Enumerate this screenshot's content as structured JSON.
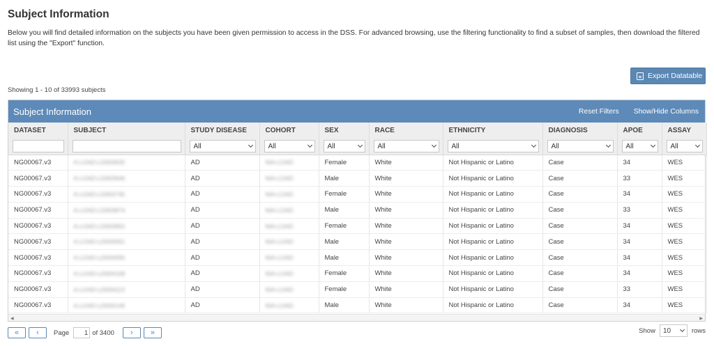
{
  "page": {
    "title": "Subject Information",
    "intro": "Below you will find detailed information on the subjects you have been given permission to access in the DSS. For advanced browsing, use the filtering functionality to find a subset of samples, then download the filtered list using the \"Export\" function.",
    "export_label": "Export Datatable",
    "showing": "Showing 1 - 10 of 33993 subjects"
  },
  "panel": {
    "title": "Subject Information",
    "reset_filters": "Reset Filters",
    "show_hide_columns": "Show/Hide Columns"
  },
  "columns": [
    "DATASET",
    "SUBJECT",
    "STUDY DISEASE",
    "COHORT",
    "SEX",
    "RACE",
    "ETHNICITY",
    "DIAGNOSIS",
    "APOE",
    "ASSAY"
  ],
  "filters": {
    "dataset": "",
    "subject": "",
    "study_disease": "All",
    "cohort": "All",
    "sex": "All",
    "race": "All",
    "ethnicity": "All",
    "diagnosis": "All",
    "apoe": "All",
    "assay": "All"
  },
  "rows": [
    {
      "dataset": "NG00067.v3",
      "subject": "A-LOAD-LD003635",
      "study_disease": "AD",
      "cohort": "NIA-LOAD",
      "sex": "Female",
      "race": "White",
      "ethnicity": "Not Hispanic or Latino",
      "diagnosis": "Case",
      "apoe": "34",
      "assay": "WES"
    },
    {
      "dataset": "NG00067.v3",
      "subject": "A-LOAD-LD003646",
      "study_disease": "AD",
      "cohort": "NIA-LOAD",
      "sex": "Male",
      "race": "White",
      "ethnicity": "Not Hispanic or Latino",
      "diagnosis": "Case",
      "apoe": "33",
      "assay": "WES"
    },
    {
      "dataset": "NG00067.v3",
      "subject": "A-LOAD-LD003745",
      "study_disease": "AD",
      "cohort": "NIA-LOAD",
      "sex": "Female",
      "race": "White",
      "ethnicity": "Not Hispanic or Latino",
      "diagnosis": "Case",
      "apoe": "34",
      "assay": "WES"
    },
    {
      "dataset": "NG00067.v3",
      "subject": "A-LOAD-LD003874",
      "study_disease": "AD",
      "cohort": "NIA-LOAD",
      "sex": "Male",
      "race": "White",
      "ethnicity": "Not Hispanic or Latino",
      "diagnosis": "Case",
      "apoe": "33",
      "assay": "WES"
    },
    {
      "dataset": "NG00067.v3",
      "subject": "A-LOAD-LD003952",
      "study_disease": "AD",
      "cohort": "NIA-LOAD",
      "sex": "Female",
      "race": "White",
      "ethnicity": "Not Hispanic or Latino",
      "diagnosis": "Case",
      "apoe": "34",
      "assay": "WES"
    },
    {
      "dataset": "NG00067.v3",
      "subject": "A-LOAD-LD004061",
      "study_disease": "AD",
      "cohort": "NIA-LOAD",
      "sex": "Male",
      "race": "White",
      "ethnicity": "Not Hispanic or Latino",
      "diagnosis": "Case",
      "apoe": "34",
      "assay": "WES"
    },
    {
      "dataset": "NG00067.v3",
      "subject": "A-LOAD-LD004095",
      "study_disease": "AD",
      "cohort": "NIA-LOAD",
      "sex": "Male",
      "race": "White",
      "ethnicity": "Not Hispanic or Latino",
      "diagnosis": "Case",
      "apoe": "34",
      "assay": "WES"
    },
    {
      "dataset": "NG00067.v3",
      "subject": "A-LOAD-LD004108",
      "study_disease": "AD",
      "cohort": "NIA-LOAD",
      "sex": "Female",
      "race": "White",
      "ethnicity": "Not Hispanic or Latino",
      "diagnosis": "Case",
      "apoe": "34",
      "assay": "WES"
    },
    {
      "dataset": "NG00067.v3",
      "subject": "A-LOAD-LD004113",
      "study_disease": "AD",
      "cohort": "NIA-LOAD",
      "sex": "Female",
      "race": "White",
      "ethnicity": "Not Hispanic or Latino",
      "diagnosis": "Case",
      "apoe": "33",
      "assay": "WES"
    },
    {
      "dataset": "NG00067.v3",
      "subject": "A-LOAD-LD004146",
      "study_disease": "AD",
      "cohort": "NIA-LOAD",
      "sex": "Male",
      "race": "White",
      "ethnicity": "Not Hispanic or Latino",
      "diagnosis": "Case",
      "apoe": "34",
      "assay": "WES"
    }
  ],
  "pager": {
    "first": "«",
    "prev": "‹",
    "next": "›",
    "last": "»",
    "page_label": "Page",
    "page_value": "1",
    "of_text": "of 3400",
    "show_label": "Show",
    "rows_value": "10",
    "rows_label": "rows"
  },
  "colors": {
    "accent": "#5d8ab8",
    "header_bg": "#eeeeee"
  }
}
